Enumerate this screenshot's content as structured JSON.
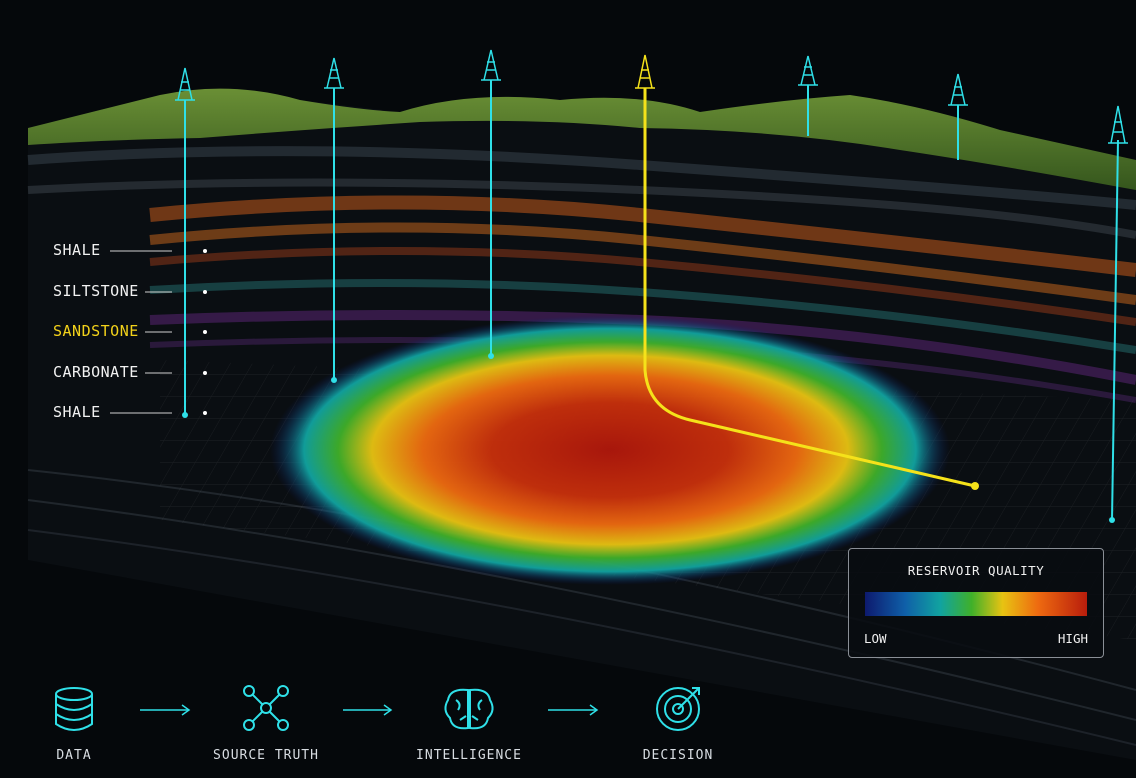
{
  "strata_labels": [
    {
      "text": "SHALE",
      "highlight": false
    },
    {
      "text": "SILTSTONE",
      "highlight": false
    },
    {
      "text": "SANDSTONE",
      "highlight": true
    },
    {
      "text": "CARBONATE",
      "highlight": false
    },
    {
      "text": "SHALE",
      "highlight": false
    }
  ],
  "legend": {
    "title": "RESERVOIR QUALITY",
    "low_label": "LOW",
    "high_label": "HIGH",
    "gradient_colors": [
      "#0d1a6e",
      "#0f5fa8",
      "#11a3a0",
      "#3fb02a",
      "#e8c312",
      "#ee6a10",
      "#b81d0c"
    ]
  },
  "workflow": {
    "steps": [
      {
        "label": "DATA",
        "icon": "database-icon"
      },
      {
        "label": "SOURCE TRUTH",
        "icon": "network-icon"
      },
      {
        "label": "INTELLIGENCE",
        "icon": "brain-icon"
      },
      {
        "label": "DECISION",
        "icon": "target-icon"
      }
    ]
  },
  "colors": {
    "well_cyan": "#2fe0e8",
    "well_highlight": "#f5e21a",
    "label_highlight": "#f3d21a",
    "terrain": "#4f7a2a",
    "background": "#05080b"
  }
}
